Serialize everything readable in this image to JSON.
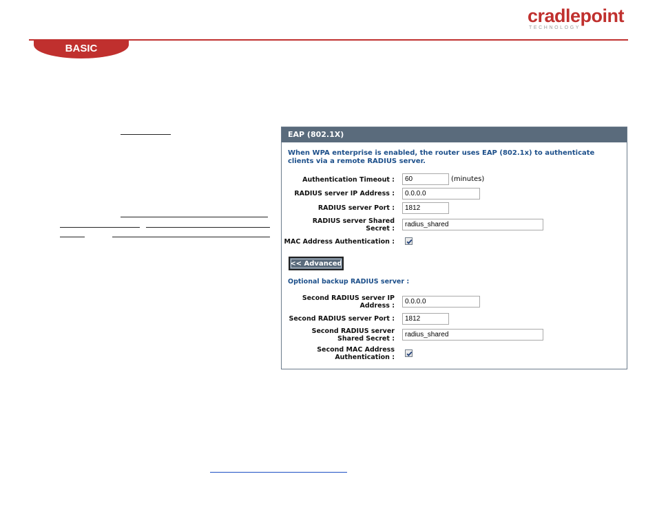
{
  "brand": {
    "logo_main": "cradlepoint",
    "logo_sub": "TECHNOLOGY"
  },
  "header": {
    "tab_label": "BASIC"
  },
  "panel": {
    "title": "EAP (802.1X)",
    "intro": "When WPA enterprise is enabled, the router uses EAP (802.1x) to authenticate clients via a remote RADIUS server.",
    "auth_timeout": {
      "label": "Authentication Timeout :",
      "value": "60",
      "unit": "(minutes)"
    },
    "radius_ip": {
      "label": "RADIUS server IP Address :",
      "value": "0.0.0.0"
    },
    "radius_port": {
      "label": "RADIUS server Port :",
      "value": "1812"
    },
    "radius_secret": {
      "label_line1": "RADIUS server Shared",
      "label_line2": "Secret :",
      "value": "radius_shared"
    },
    "mac_auth": {
      "label": "MAC Address Authentication :",
      "checked": true
    },
    "advanced_button": "<< Advanced",
    "optional_label": "Optional backup RADIUS server :",
    "second_ip": {
      "label_line1": "Second RADIUS server IP",
      "label_line2": "Address :",
      "value": "0.0.0.0"
    },
    "second_port": {
      "label": "Second RADIUS server Port :",
      "value": "1812"
    },
    "second_secret": {
      "label_line1": "Second RADIUS server",
      "label_line2": "Shared Secret :",
      "value": "radius_shared"
    },
    "second_mac": {
      "label_line1": "Second MAC Address",
      "label_line2": "Authentication :",
      "checked": true
    }
  }
}
